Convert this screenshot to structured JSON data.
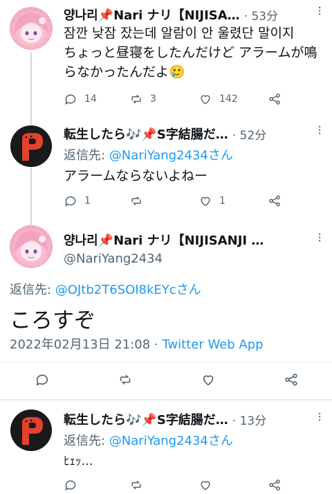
{
  "tweets": [
    {
      "name": "양나리📌Nari ナリ【NIJISA…",
      "time": "· 53分",
      "body_ko": "잠깐 낮잠 잤는데 알람이 안 울렸단 말이지",
      "body_ja": "ちょっと昼寝をしたんだけど アラームが鳴らなかったんだよ🥲",
      "reply_count": "14",
      "retweet_count": "3",
      "like_count": "142"
    },
    {
      "name": "転生したら🎶📌S字結腸だ…",
      "time": "· 52分",
      "reply_prefix": "返信先: ",
      "reply_handle": "@NariYang2434さん",
      "body": "アラームならないよねー",
      "reply_count": "1",
      "like_count": "1"
    },
    {
      "name": "転生したら🎶📌S字結腸だ…",
      "time": "· 13分",
      "reply_prefix": "返信先: ",
      "reply_handle": "@NariYang2434さん",
      "body": "ﾋｪｯ…"
    }
  ],
  "focused": {
    "name": "양나리📌Nari ナリ【NIJISANJI …",
    "handle": "@NariYang2434",
    "reply_prefix": "返信先: ",
    "reply_handle": "@OJtb2T6SOI8kEYcさん",
    "body": "ころすぞ",
    "timestamp": "2022年02月13日 21:08 · ",
    "source": "Twitter Web App"
  },
  "more_glyph": "···"
}
